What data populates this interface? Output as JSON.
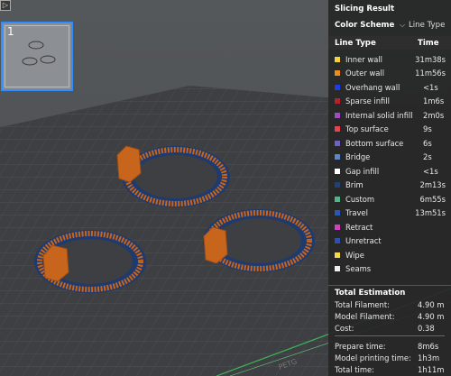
{
  "viewport": {
    "plate_thumbnail": {
      "number": "1"
    },
    "toggle_icon": "panel-toggle-icon",
    "colors": {
      "plate": "#3c3d3f",
      "grid": "#4b4d50",
      "part": "#c8651d",
      "brim": "#1e3a6e"
    }
  },
  "panel": {
    "title": "Slicing Result",
    "color_scheme_label": "Color Scheme",
    "color_scheme_value": "Line Type",
    "columns": {
      "type": "Line Type",
      "time": "Time"
    },
    "line_types": [
      {
        "label": "Inner wall",
        "time": "31m38s",
        "color": "#f5d23a"
      },
      {
        "label": "Outer wall",
        "time": "11m56s",
        "color": "#f08a1c"
      },
      {
        "label": "Overhang wall",
        "time": "<1s",
        "color": "#1f3de0"
      },
      {
        "label": "Sparse infill",
        "time": "1m6s",
        "color": "#b5222b"
      },
      {
        "label": "Internal solid infill",
        "time": "2m0s",
        "color": "#9a4dc4"
      },
      {
        "label": "Top surface",
        "time": "9s",
        "color": "#e8424e"
      },
      {
        "label": "Bottom surface",
        "time": "6s",
        "color": "#6d62c4"
      },
      {
        "label": "Bridge",
        "time": "2s",
        "color": "#5b87c9"
      },
      {
        "label": "Gap infill",
        "time": "<1s",
        "color": "#ffffff"
      },
      {
        "label": "Brim",
        "time": "2m13s",
        "color": "#223f7a"
      },
      {
        "label": "Custom",
        "time": "6m55s",
        "color": "#52b48c"
      },
      {
        "label": "Travel",
        "time": "13m51s",
        "color": "#2a56b6"
      },
      {
        "label": "Retract",
        "time": "",
        "color": "#d13fc3"
      },
      {
        "label": "Unretract",
        "time": "",
        "color": "#2d4fb0"
      },
      {
        "label": "Wipe",
        "time": "",
        "color": "#f5d94a"
      },
      {
        "label": "Seams",
        "time": "",
        "color": "#efefef"
      }
    ],
    "total_title": "Total Estimation",
    "estimation": [
      {
        "label": "Total Filament:",
        "value": "4.90 m"
      },
      {
        "label": "Model Filament:",
        "value": "4.90 m"
      },
      {
        "label": "Cost:",
        "value": "0.38"
      },
      {
        "label": "Prepare time:",
        "value": "8m6s"
      },
      {
        "label": "Model printing time:",
        "value": "1h3m"
      },
      {
        "label": "Total time:",
        "value": "1h11m"
      }
    ]
  }
}
